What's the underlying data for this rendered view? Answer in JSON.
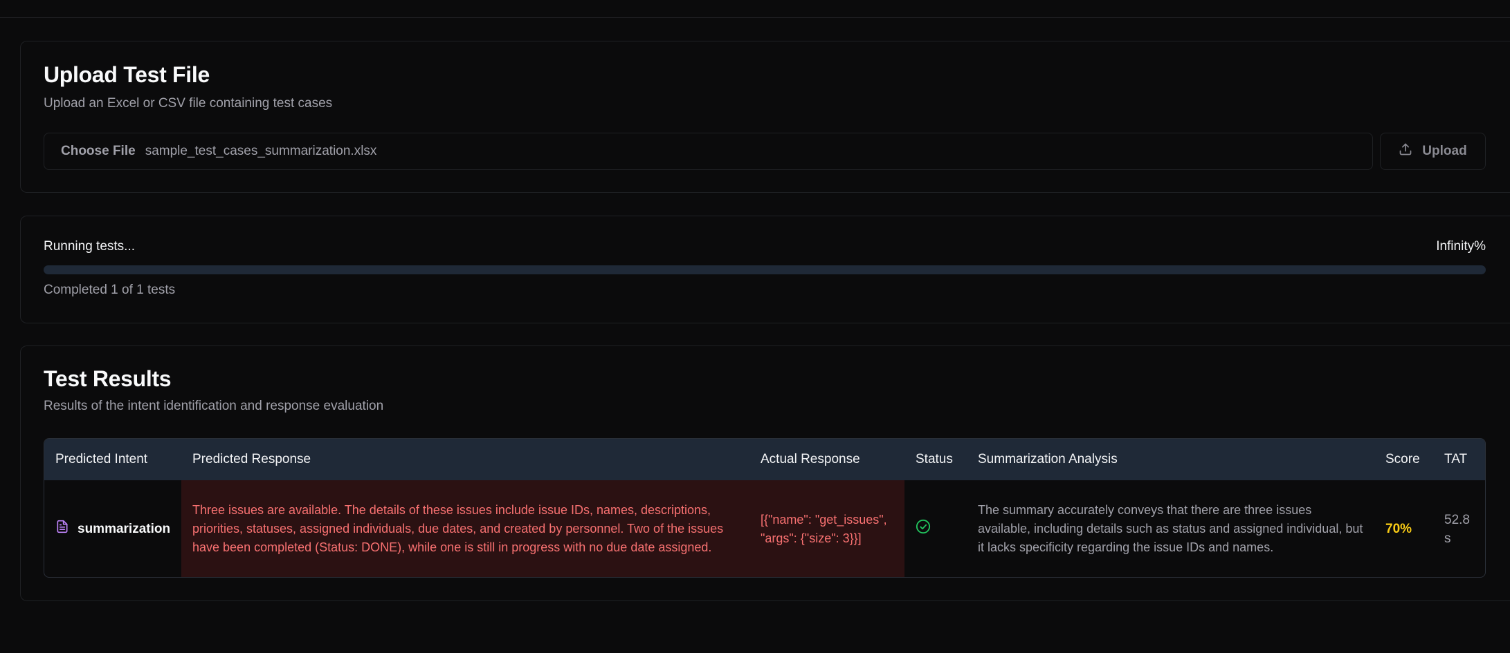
{
  "upload": {
    "title": "Upload Test File",
    "subtitle": "Upload an Excel or CSV file containing test cases",
    "choose_label": "Choose File",
    "file_name": "sample_test_cases_summarization.xlsx",
    "upload_label": "Upload",
    "upload_icon": "upload-icon"
  },
  "progress": {
    "label": "Running tests...",
    "percent_text": "Infinity%",
    "completed_text": "Completed 1 of 1 tests",
    "fill_fraction": 0
  },
  "results": {
    "title": "Test Results",
    "subtitle": "Results of the intent identification and response evaluation",
    "columns": [
      "Predicted Intent",
      "Predicted Response",
      "Actual Response",
      "Status",
      "Summarization Analysis",
      "Score",
      "TAT"
    ],
    "rows": [
      {
        "intent": "summarization",
        "intent_icon": "document-icon",
        "predicted_response": "Three issues are available. The details of these issues include issue IDs, names, descriptions, priorities, statuses, assigned individuals, due dates, and created by personnel. Two of the issues have been completed (Status: DONE), while one is still in progress with no due date assigned.",
        "actual_response": "[{\"name\": \"get_issues\", \"args\": {\"size\": 3}}]",
        "status_icon": "check-circle-icon",
        "analysis": "The summary accurately conveys that there are three issues available, including details such as status and assigned individual, but it lacks specificity regarding the issue IDs and names.",
        "score": "70%",
        "tat": "52.8 s"
      }
    ]
  },
  "colors": {
    "background": "#0b0b0c",
    "error_cell_bg": "#2b1112",
    "error_text": "#f87171",
    "success": "#22c55e",
    "score": "#facc15",
    "intent_icon": "#c084fc",
    "table_header": "#1f2937"
  }
}
